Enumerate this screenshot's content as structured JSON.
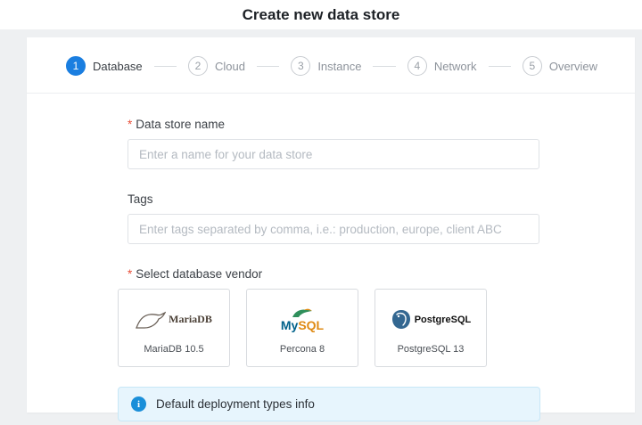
{
  "page": {
    "title": "Create new data store"
  },
  "stepper": {
    "steps": [
      {
        "number": "1",
        "label": "Database",
        "active": true
      },
      {
        "number": "2",
        "label": "Cloud",
        "active": false
      },
      {
        "number": "3",
        "label": "Instance",
        "active": false
      },
      {
        "number": "4",
        "label": "Network",
        "active": false
      },
      {
        "number": "5",
        "label": "Overview",
        "active": false
      }
    ]
  },
  "form": {
    "required_mark": "*",
    "name_field": {
      "label": "Data store name",
      "placeholder": "Enter a name for your data store",
      "value": ""
    },
    "tags_field": {
      "label": "Tags",
      "placeholder": "Enter tags separated by comma, i.e.: production, europe, client ABC",
      "value": ""
    },
    "vendor": {
      "label": "Select database vendor",
      "options": [
        {
          "name": "MariaDB 10.5",
          "logo_text": "MariaDB"
        },
        {
          "name": "Percona 8",
          "logo_text_a": "My",
          "logo_text_b": "SQL"
        },
        {
          "name": "PostgreSQL 13",
          "logo_text": "PostgreSQL"
        }
      ]
    },
    "info_banner": {
      "icon_glyph": "i",
      "text": "Default deployment types info"
    }
  },
  "colors": {
    "accent": "#1a7ee0",
    "required": "#e8503a",
    "info_background": "#e7f5fd",
    "info_icon": "#1a8fd9"
  }
}
